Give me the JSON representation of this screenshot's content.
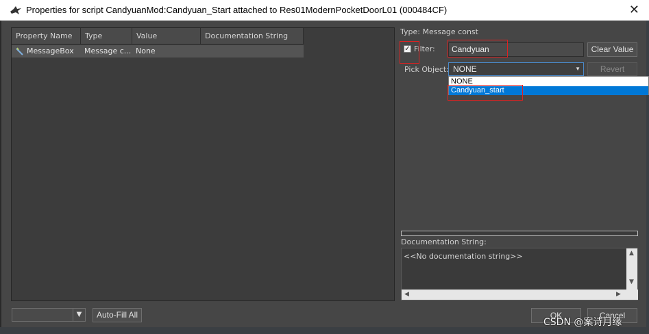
{
  "window": {
    "title": "Properties for script CandyuanMod:Candyuan_Start attached to Res01ModernPocketDoorL01 (000484CF)",
    "close_glyph": "✕",
    "icon": "skyrim-dragon-icon"
  },
  "list": {
    "columns": [
      "Property Name",
      "Type",
      "Value",
      "Documentation String"
    ],
    "rows": [
      {
        "name": "MessageBox",
        "type": "Message c...",
        "value": "None",
        "doc": ""
      }
    ]
  },
  "details": {
    "type_label": "Type: Message const",
    "filter_checked": true,
    "filter_label": "Filter:",
    "filter_value": "Candyuan",
    "clear_value_label": "Clear Value",
    "pick_label": "Pick Object:",
    "pick_value": "NONE",
    "revert_label": "Revert",
    "dropdown_options": [
      "NONE",
      "Candyuan_start"
    ],
    "dropdown_selected": "Candyuan_start",
    "doc_label": "Documentation String:",
    "doc_text": "<<No documentation string>>"
  },
  "footer": {
    "combo_value": "",
    "autofill_label": "Auto-Fill All",
    "ok_label": "OK",
    "cancel_label": "Cancel"
  },
  "watermark": "CSDN @案诗月缘",
  "colors": {
    "dialog_bg": "#464646",
    "list_bg": "#3c3c3c",
    "selection_blue": "#0078d7",
    "highlight_red": "#e02020"
  }
}
